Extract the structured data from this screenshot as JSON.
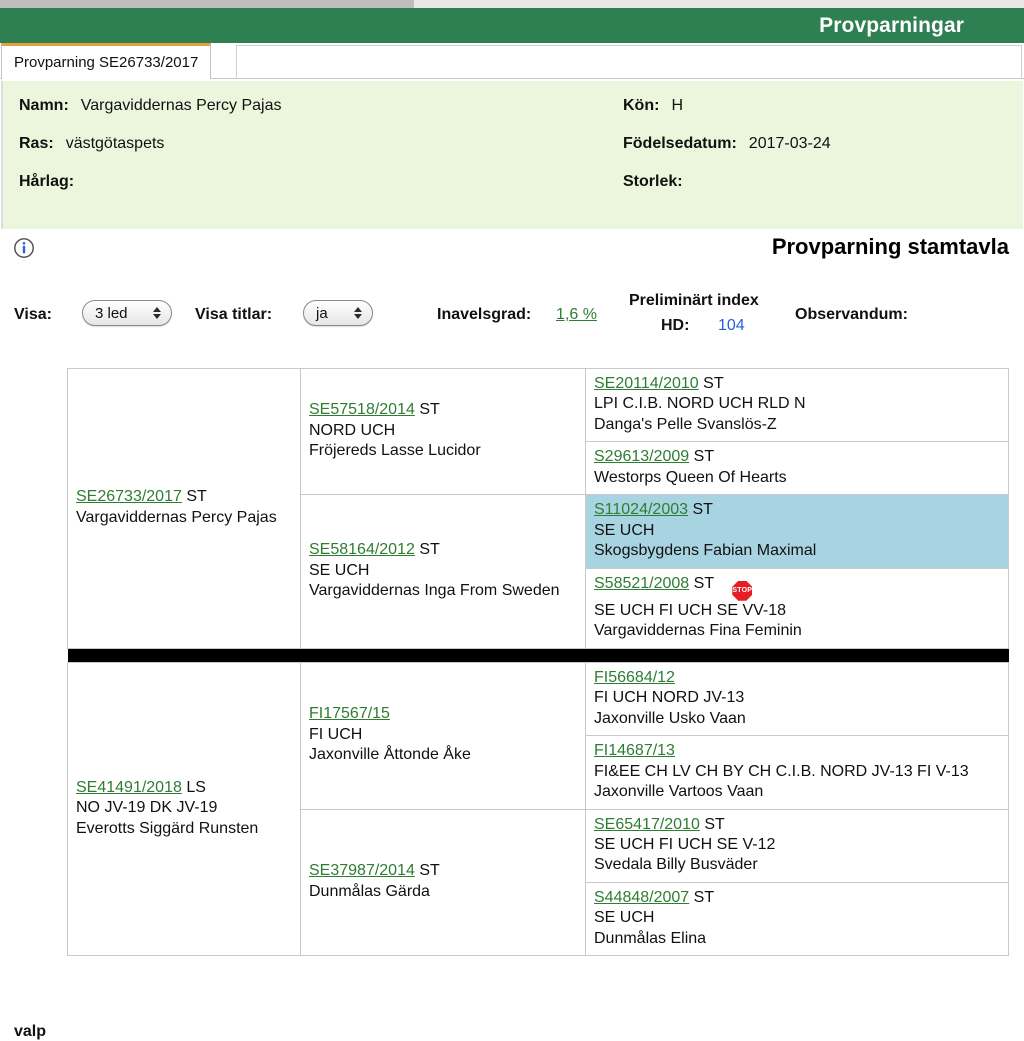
{
  "window": {
    "header_title": "Provparningar",
    "accent_green": "#2e8052",
    "tab_accent": "#e8a13a"
  },
  "tabs": [
    {
      "label": "Provparning SE26733/2017",
      "active": true
    }
  ],
  "info_panel": {
    "fields": [
      {
        "label": "Namn:",
        "value": "Vargaviddernas Percy Pajas"
      },
      {
        "label": "Kön:",
        "value": "H"
      },
      {
        "label": "Ras:",
        "value": "västgötaspets"
      },
      {
        "label": "Födelsedatum:",
        "value": "2017-03-24"
      },
      {
        "label": "Hårlag:",
        "value": ""
      },
      {
        "label": "Storlek:",
        "value": ""
      }
    ]
  },
  "section": {
    "info_icon": "info-circle-icon",
    "title": "Provparning stamtavla"
  },
  "options": {
    "visa_label": "Visa:",
    "visa_value": "3 led",
    "visa_titlar_label": "Visa titlar:",
    "visa_titlar_value": "ja",
    "inavelsgrad_label": "Inavelsgrad:",
    "inavelsgrad_value": "1,6 %",
    "prelim_index_label": "Preliminärt index",
    "hd_label": "HD:",
    "hd_value": "104",
    "observandum_label": "Observandum:"
  },
  "pedigree": {
    "valp_label": "valp",
    "highlight_color": "#a8d4e2",
    "sire_side": {
      "gen1": {
        "reg": "SE26733/2017",
        "suffix": "ST",
        "titles": "",
        "name": "Vargaviddernas Percy Pajas"
      },
      "gen2": [
        {
          "reg": "SE57518/2014",
          "suffix": "ST",
          "titles": "NORD UCH",
          "name": "Fröjereds Lasse Lucidor"
        },
        {
          "reg": "SE58164/2012",
          "suffix": "ST",
          "titles": "SE UCH",
          "name": "Vargaviddernas Inga From Sweden"
        }
      ],
      "gen3": [
        {
          "reg": "SE20114/2010",
          "suffix": "ST",
          "titles": "LPI C.I.B. NORD UCH RLD N",
          "name": "Danga's Pelle Svanslös-Z",
          "highlight": false,
          "stop": false
        },
        {
          "reg": "S29613/2009",
          "suffix": "ST",
          "titles": "",
          "name": "Westorps Queen Of Hearts",
          "highlight": false,
          "stop": false
        },
        {
          "reg": "S11024/2003",
          "suffix": "ST",
          "titles": "SE UCH",
          "name": "Skogsbygdens Fabian Maximal",
          "highlight": true,
          "stop": false
        },
        {
          "reg": "S58521/2008",
          "suffix": "ST",
          "titles": "SE UCH FI UCH SE VV-18",
          "name": "Vargaviddernas Fina Feminin",
          "highlight": false,
          "stop": true
        }
      ]
    },
    "dam_side": {
      "gen1": {
        "reg": "SE41491/2018",
        "suffix": "LS",
        "titles": "NO JV-19 DK JV-19",
        "name": "Everotts Siggärd Runsten"
      },
      "gen2": [
        {
          "reg": "FI17567/15",
          "suffix": "",
          "titles": "FI UCH",
          "name": "Jaxonville Åttonde Åke"
        },
        {
          "reg": "SE37987/2014",
          "suffix": "ST",
          "titles": "",
          "name": "Dunmålas Gärda"
        }
      ],
      "gen3": [
        {
          "reg": "FI56684/12",
          "suffix": "",
          "titles": "FI UCH NORD JV-13",
          "name": "Jaxonville Usko Vaan",
          "highlight": false,
          "stop": false
        },
        {
          "reg": "FI14687/13",
          "suffix": "",
          "titles": "FI&EE CH LV CH BY CH C.I.B. NORD JV-13 FI V-13",
          "name": "Jaxonville Vartoos Vaan",
          "highlight": false,
          "stop": false
        },
        {
          "reg": "SE65417/2010",
          "suffix": "ST",
          "titles": "SE UCH FI UCH SE V-12",
          "name": "Svedala Billy Busväder",
          "highlight": false,
          "stop": false
        },
        {
          "reg": "S44848/2007",
          "suffix": "ST",
          "titles": "SE UCH",
          "name": "Dunmålas Elina",
          "highlight": false,
          "stop": false
        }
      ]
    },
    "stop_badge_label": "STOP"
  }
}
